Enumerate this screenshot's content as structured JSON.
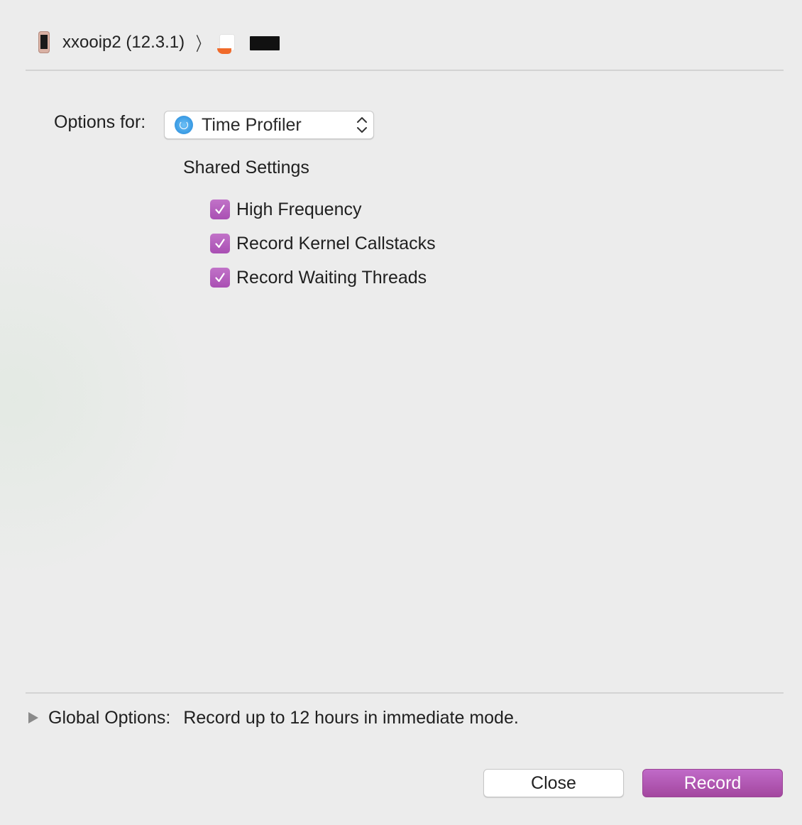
{
  "path_bar": {
    "device_label": "xxooip2 (12.3.1)",
    "separator": "〉",
    "device_icon": "iphone-icon",
    "app_icon": "app-icon",
    "redacted_icon": "redacted-block"
  },
  "options": {
    "label": "Options for:",
    "selected_template": "Time Profiler",
    "template_icon": "time-profiler-icon"
  },
  "shared_settings": {
    "title": "Shared Settings",
    "items": [
      {
        "label": "High Frequency",
        "checked": true
      },
      {
        "label": "Record Kernel Callstacks",
        "checked": true
      },
      {
        "label": "Record Waiting Threads",
        "checked": true
      }
    ]
  },
  "global_options": {
    "label": "Global Options:",
    "value": "Record up to 12 hours in immediate mode."
  },
  "buttons": {
    "close_label": "Close",
    "record_label": "Record"
  },
  "colors": {
    "accent": "#b05bbb",
    "background": "#ececec",
    "divider": "#d3d3d3"
  }
}
